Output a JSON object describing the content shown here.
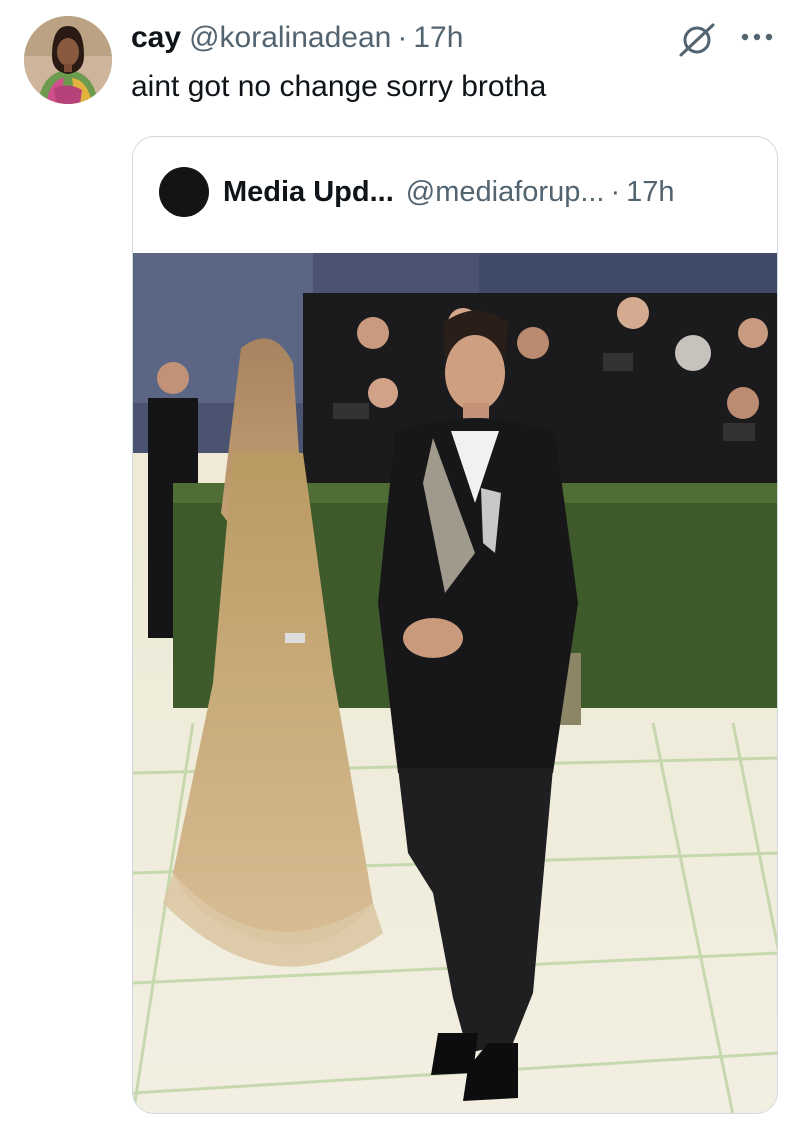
{
  "tweet": {
    "display_name": "cay",
    "handle": "@koralinadean",
    "separator": "·",
    "time": "17h",
    "text": "aint got no change sorry brotha",
    "icons": {
      "grok": "grok-icon",
      "more": "more-options-icon"
    }
  },
  "quote": {
    "display_name": "Media Upd...",
    "handle": "@mediaforup...",
    "separator": "·",
    "time": "17h",
    "media_kind": "photo"
  },
  "colors": {
    "text_primary": "#0f1419",
    "text_secondary": "#536471",
    "card_border": "#cfd9de"
  }
}
